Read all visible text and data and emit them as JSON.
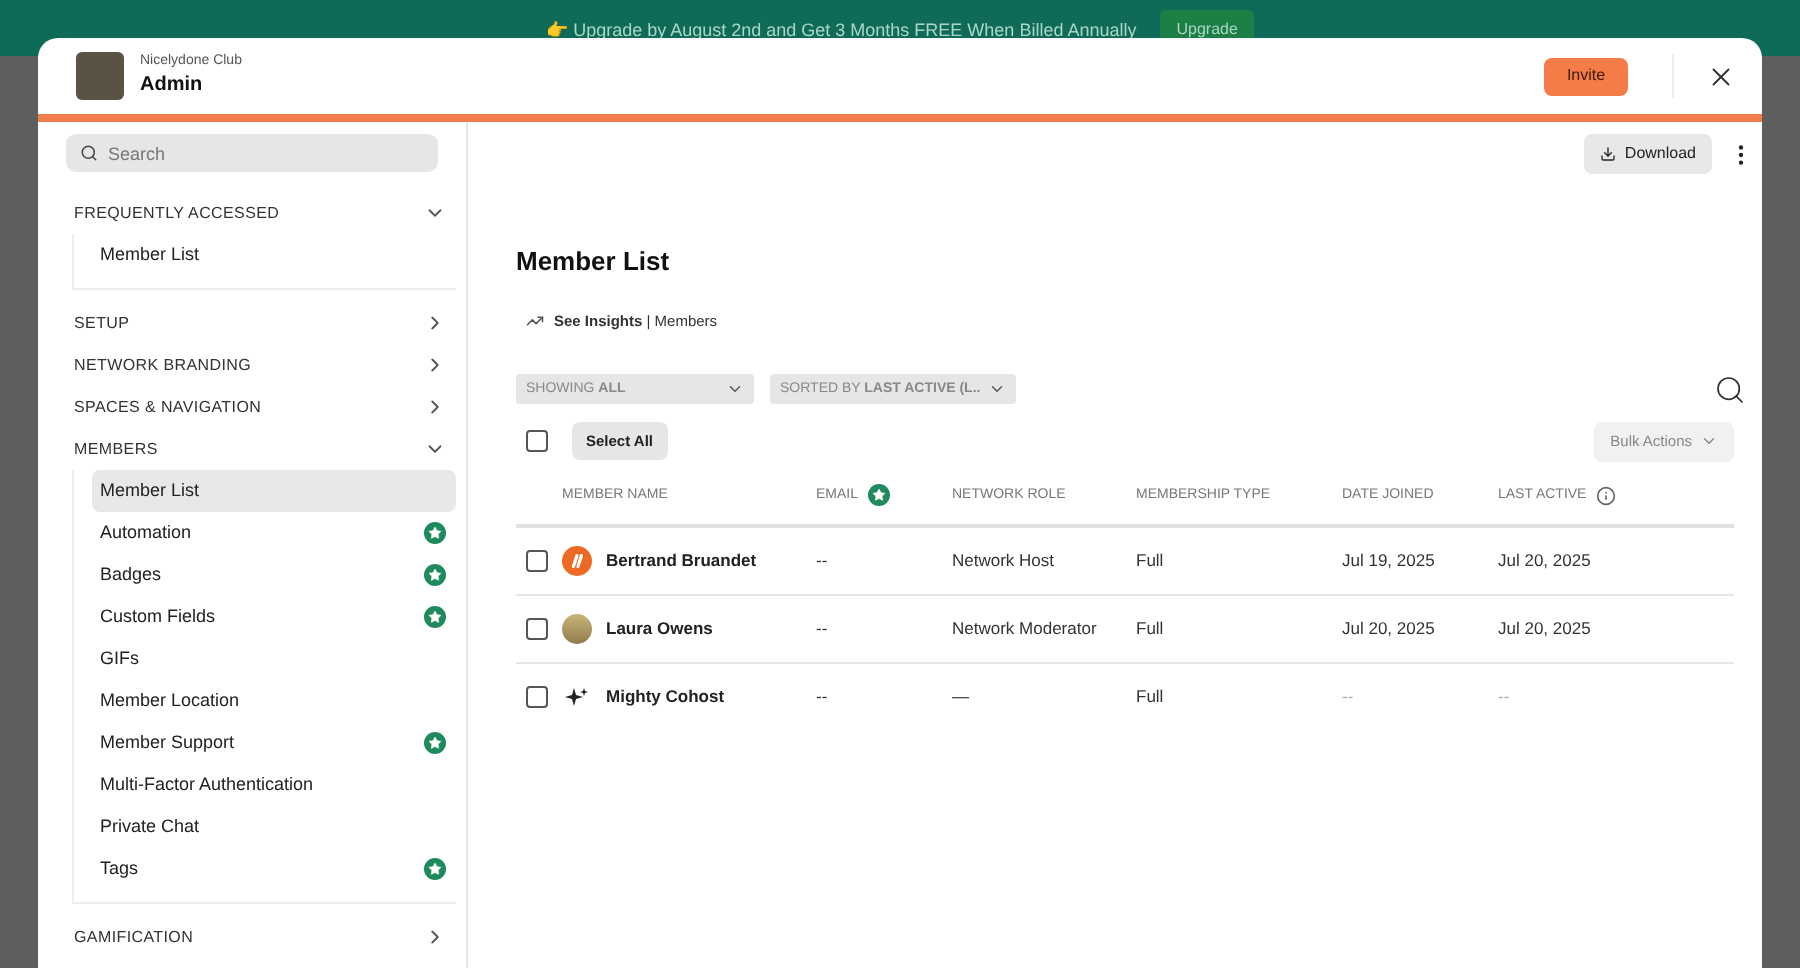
{
  "banner": {
    "text": "👉 Upgrade by August 2nd and Get 3 Months FREE When Billed Annually",
    "button": "Upgrade"
  },
  "header": {
    "community": "Nicelydone Club",
    "title": "Admin",
    "invite_button": "Invite"
  },
  "sidebar": {
    "search": {
      "placeholder": "Search"
    },
    "sections": [
      {
        "label": "FREQUENTLY ACCESSED",
        "expanded": true,
        "items": [
          {
            "label": "Member List",
            "selected": false,
            "premium": false
          }
        ]
      },
      {
        "label": "SETUP",
        "expanded": false
      },
      {
        "label": "NETWORK BRANDING",
        "expanded": false
      },
      {
        "label": "SPACES & NAVIGATION",
        "expanded": false
      },
      {
        "label": "MEMBERS",
        "expanded": true,
        "items": [
          {
            "label": "Member List",
            "selected": true,
            "premium": false
          },
          {
            "label": "Automation",
            "selected": false,
            "premium": true
          },
          {
            "label": "Badges",
            "selected": false,
            "premium": true
          },
          {
            "label": "Custom Fields",
            "selected": false,
            "premium": true
          },
          {
            "label": "GIFs",
            "selected": false,
            "premium": false
          },
          {
            "label": "Member Location",
            "selected": false,
            "premium": false
          },
          {
            "label": "Member Support",
            "selected": false,
            "premium": true
          },
          {
            "label": "Multi-Factor Authentication",
            "selected": false,
            "premium": false
          },
          {
            "label": "Private Chat",
            "selected": false,
            "premium": false
          },
          {
            "label": "Tags",
            "selected": false,
            "premium": true
          }
        ]
      },
      {
        "label": "GAMIFICATION",
        "expanded": false
      }
    ]
  },
  "main": {
    "download_button": "Download",
    "title": "Member List",
    "insights": "**See Insights** | Members",
    "filters": [
      "SHOWING **ALL**",
      "SORTED BY **LAST ACTIVE (L..**"
    ],
    "select_all": {
      "label": "Select All",
      "checked": false
    },
    "bulk_actions": "Bulk Actions",
    "table": {
      "columns": [
        {
          "label": "MEMBER NAME",
          "kind": "plain"
        },
        {
          "label": "EMAIL",
          "kind": "premium"
        },
        {
          "label": "NETWORK ROLE",
          "kind": "plain"
        },
        {
          "label": "MEMBERSHIP TYPE",
          "kind": "plain"
        },
        {
          "label": "DATE JOINED",
          "kind": "plain"
        },
        {
          "label": "LAST ACTIVE",
          "kind": "info"
        }
      ],
      "rows": [
        {
          "checked": false,
          "kind": "logo",
          "cells": [
            "Bertrand Bruandet",
            "--",
            "Network Host",
            "Full",
            "Jul 19, 2025",
            "Jul 20, 2025"
          ]
        },
        {
          "checked": false,
          "kind": "photo",
          "cells": [
            "Laura Owens",
            "--",
            "Network Moderator",
            "Full",
            "Jul 20, 2025",
            "Jul 20, 2025"
          ]
        },
        {
          "checked": false,
          "kind": "sparkle",
          "cells": [
            "Mighty Cohost",
            "--",
            "—",
            "Full",
            "--",
            "--"
          ]
        }
      ]
    }
  }
}
